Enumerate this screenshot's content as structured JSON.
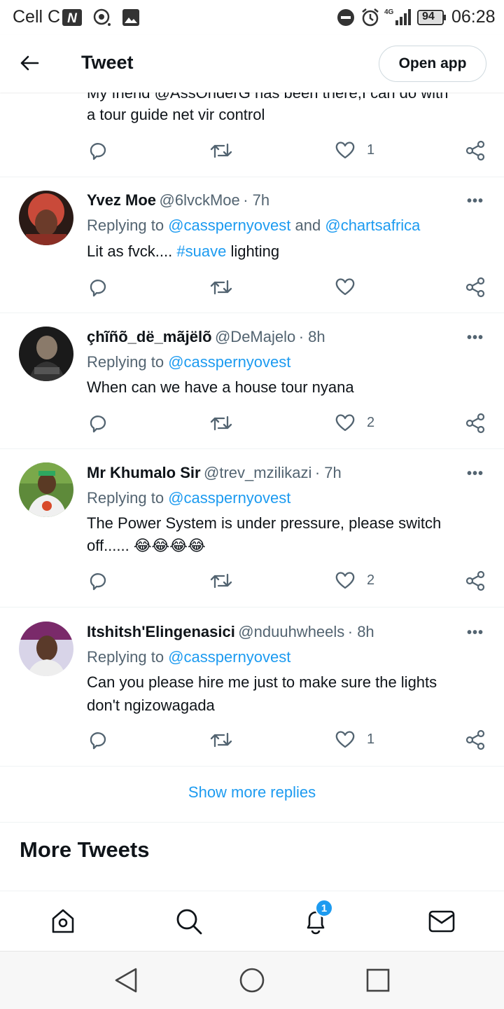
{
  "status_bar": {
    "carrier": "Cell C",
    "network": "4G",
    "battery": "94",
    "time": "06:28"
  },
  "header": {
    "title": "Tweet",
    "open_app_label": "Open app"
  },
  "partial_tweet": {
    "line1": "My friend @AssOnderG has been there,I can do with",
    "line2": "a tour guide net vir control",
    "like_count": "1"
  },
  "replies": [
    {
      "name": "Yvez Moe",
      "handle": "@6lvckMoe",
      "time": "· 7h",
      "replying_prefix": "Replying to",
      "replying_to_1": "@casspernyovest",
      "replying_and": "and",
      "replying_to_2": "@chartsafrica",
      "text_before": "Lit as fvck.... ",
      "hashtag": "#suave",
      "text_after": " lighting",
      "like_count": ""
    },
    {
      "name": "çhĩñõ_dë_mãjëlõ",
      "handle": "@DeMajelo",
      "time": "· 8h",
      "replying_prefix": "Replying to",
      "replying_to_1": "@casspernyovest",
      "text": "When can we have a house tour nyana",
      "like_count": "2"
    },
    {
      "name": "Mr Khumalo Sir",
      "handle": "@trev_mzilikazi",
      "time": "· 7h",
      "replying_prefix": "Replying to",
      "replying_to_1": "@casspernyovest",
      "text_line1": "The Power System is under pressure, please switch",
      "text_line2": "off...... 😂😂😂😂",
      "like_count": "2"
    },
    {
      "name": "Itshitsh'Elingenasici",
      "handle": "@nduuhwheels",
      "time": "· 8h",
      "replying_prefix": "Replying to",
      "replying_to_1": "@casspernyovest",
      "text_line1": "Can you please hire me just to make sure the lights",
      "text_line2": "don't ngizowagada",
      "like_count": "1"
    }
  ],
  "show_more_label": "Show more replies",
  "more_tweets_title": "More Tweets",
  "more_menu": "•••",
  "bottom_nav": {
    "notification_badge": "1"
  },
  "colors": {
    "accent": "#1d9bf0",
    "text": "#0f1419",
    "secondary": "#536471"
  }
}
